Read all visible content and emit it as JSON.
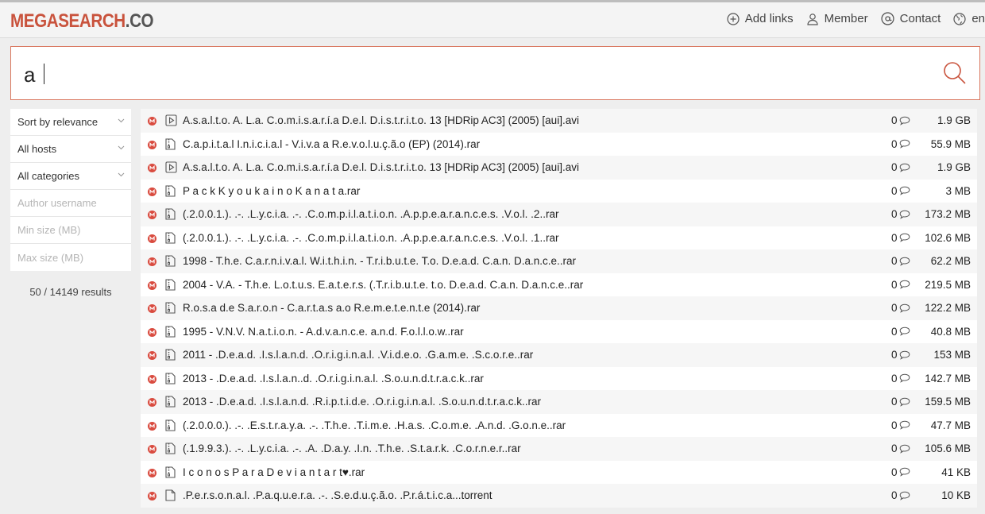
{
  "header": {
    "logo_brand": "MEGASEARCH",
    "logo_tld": ".CO",
    "nav": [
      {
        "label": "Add links",
        "icon": "plus-circle-icon"
      },
      {
        "label": "Member",
        "icon": "user-icon"
      },
      {
        "label": "Contact",
        "icon": "at-icon"
      },
      {
        "label": "en",
        "icon": "globe-icon"
      }
    ]
  },
  "search": {
    "value": "a",
    "icon": "search-icon"
  },
  "sidebar": {
    "sort": "Sort by relevance",
    "hosts": "All hosts",
    "categories": "All categories",
    "author_placeholder": "Author username",
    "min_placeholder": "Min size (MB)",
    "max_placeholder": "Max size (MB)",
    "result_count": "50 / 14149 results"
  },
  "colors": {
    "accent": "#c9533d",
    "host_icon": "#d94b3f"
  },
  "results": [
    {
      "title": "A.s.a.l.t.o. A. L.a. C.o.m.i.s.a.r.í.a D.e.l. D.i.s.t.r.i.t.o. 13 [HDRip AC3] (2005) [aui].avi",
      "type": "video",
      "comments": "0",
      "size": "1.9 GB"
    },
    {
      "title": "C.a.p.i.t.a.l I.n.i.c.i.a.l - V.i.v.a a R.e.v.o.l.u.ç.ã.o (EP) (2014).rar",
      "type": "archive",
      "comments": "0",
      "size": "55.9 MB"
    },
    {
      "title": "A.s.a.l.t.o. A. L.a. C.o.m.i.s.a.r.í.a D.e.l. D.i.s.t.r.i.t.o. 13 [HDRip AC3] (2005) [aui].avi",
      "type": "video",
      "comments": "0",
      "size": "1.9 GB"
    },
    {
      "title": "P a c k K y o u k a i n o K a n a t a.rar",
      "type": "archive",
      "comments": "0",
      "size": "3 MB"
    },
    {
      "title": "(.2.0.0.1.). .-. .L.y.c.i.a. .-. .C.o.m.p.i.l.a.t.i.o.n. .A.p.p.e.a.r.a.n.c.e.s. .V.o.l. .2..rar",
      "type": "archive",
      "comments": "0",
      "size": "173.2 MB"
    },
    {
      "title": "(.2.0.0.1.). .-. .L.y.c.i.a. .-. .C.o.m.p.i.l.a.t.i.o.n. .A.p.p.e.a.r.a.n.c.e.s. .V.o.l. .1..rar",
      "type": "archive",
      "comments": "0",
      "size": "102.6 MB"
    },
    {
      "title": "1998 - T.h.e. C.a.r.n.i.v.a.l. W.i.t.h.i.n. - T.r.i.b.u.t.e. T.o. D.e.a.d. C.a.n. D.a.n.c.e..rar",
      "type": "archive",
      "comments": "0",
      "size": "62.2 MB"
    },
    {
      "title": "2004 - V.A. - T.h.e. L.o.t.u.s. E.a.t.e.r.s. (.T.r.i.b.u.t.e. t.o. D.e.a.d. C.a.n. D.a.n.c.e..rar",
      "type": "archive",
      "comments": "0",
      "size": "219.5 MB"
    },
    {
      "title": "R.o.s.a d.e S.a.r.o.n - C.a.r.t.a.s a.o R.e.m.e.t.e.n.t.e (2014).rar",
      "type": "archive",
      "comments": "0",
      "size": "122.2 MB"
    },
    {
      "title": "1995 - V.N.V. N.a.t.i.o.n. - A.d.v.a.n.c.e. a.n.d. F.o.l.l.o.w..rar",
      "type": "archive",
      "comments": "0",
      "size": "40.8 MB"
    },
    {
      "title": "2011 - .D.e.a.d. .I.s.l.a.n.d. .O.r.i.g.i.n.a.l. .V.i.d.e.o. .G.a.m.e. .S.c.o.r.e..rar",
      "type": "archive",
      "comments": "0",
      "size": "153 MB"
    },
    {
      "title": "2013 - .D.e.a.d. .I.s.l.a.n..d. .O.r.i.g.i.n.a.l. .S.o.u.n.d.t.r.a.c.k..rar",
      "type": "archive",
      "comments": "0",
      "size": "142.7 MB"
    },
    {
      "title": "2013 - .D.e.a.d. .I.s.l.a.n.d. .R.i.p.t.i.d.e. .O.r.i.g.i.n.a.l. .S.o.u.n.d.t.r.a.c.k..rar",
      "type": "archive",
      "comments": "0",
      "size": "159.5 MB"
    },
    {
      "title": "(.2.0.0.0.). .-. .E.s.t.r.a.y.a. .-. .T.h.e. .T.i.m.e. .H.a.s. .C.o.m.e. .A.n.d. .G.o.n.e..rar",
      "type": "archive",
      "comments": "0",
      "size": "47.7 MB"
    },
    {
      "title": "(.1.9.9.3.). .-. .L.y.c.i.a. .-. .A. .D.a.y. .I.n. .T.h.e. .S.t.a.r.k. .C.o.r.n.e.r..rar",
      "type": "archive",
      "comments": "0",
      "size": "105.6 MB"
    },
    {
      "title": "I c o n o s P a r a D e v i a n t a r t♥.rar",
      "type": "archive",
      "comments": "0",
      "size": "41 KB"
    },
    {
      "title": ".P.e.r.s.o.n.a.l. .P.a.q.u.e.r.a. .-. .S.e.d.u.ç.ã.o. .P.r.á.t.i.c.a...torrent",
      "type": "file",
      "comments": "0",
      "size": "10 KB"
    }
  ]
}
